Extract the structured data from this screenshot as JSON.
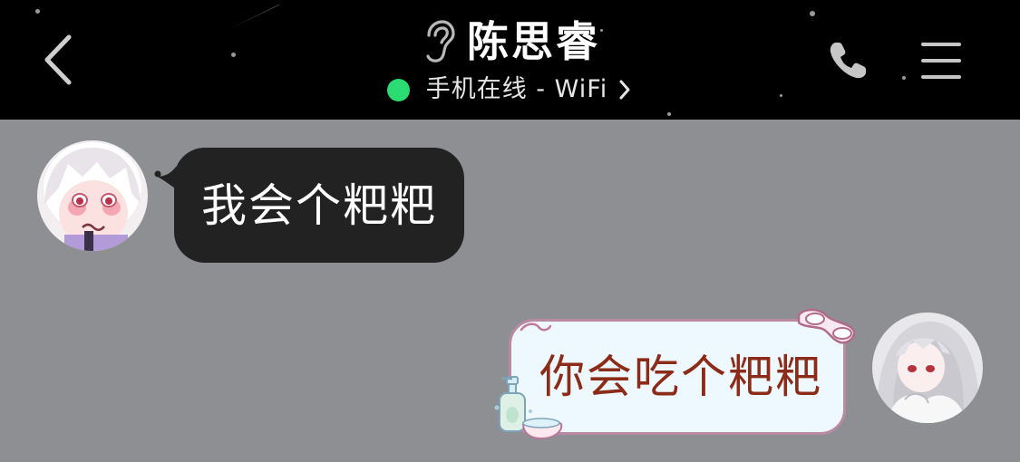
{
  "header": {
    "contact_name": "陈思睿",
    "status_text": "手机在线 - WiFi",
    "status_color": "#2bdb73",
    "background": "#000000",
    "icons": {
      "back": "chevron-left-icon",
      "ear": "ear-icon",
      "status_chevron": "chevron-right-icon",
      "phone": "phone-icon",
      "menu": "hamburger-menu-icon"
    }
  },
  "chat": {
    "background": "#8e8f93",
    "messages": [
      {
        "side": "left",
        "text": "我会个粑粑",
        "bubble_color": "#222222",
        "text_color": "#ffffff"
      },
      {
        "side": "right",
        "text": "你会吃个粑粑",
        "bubble_color": "#edf9ff",
        "text_color": "#8c2b18"
      }
    ]
  }
}
